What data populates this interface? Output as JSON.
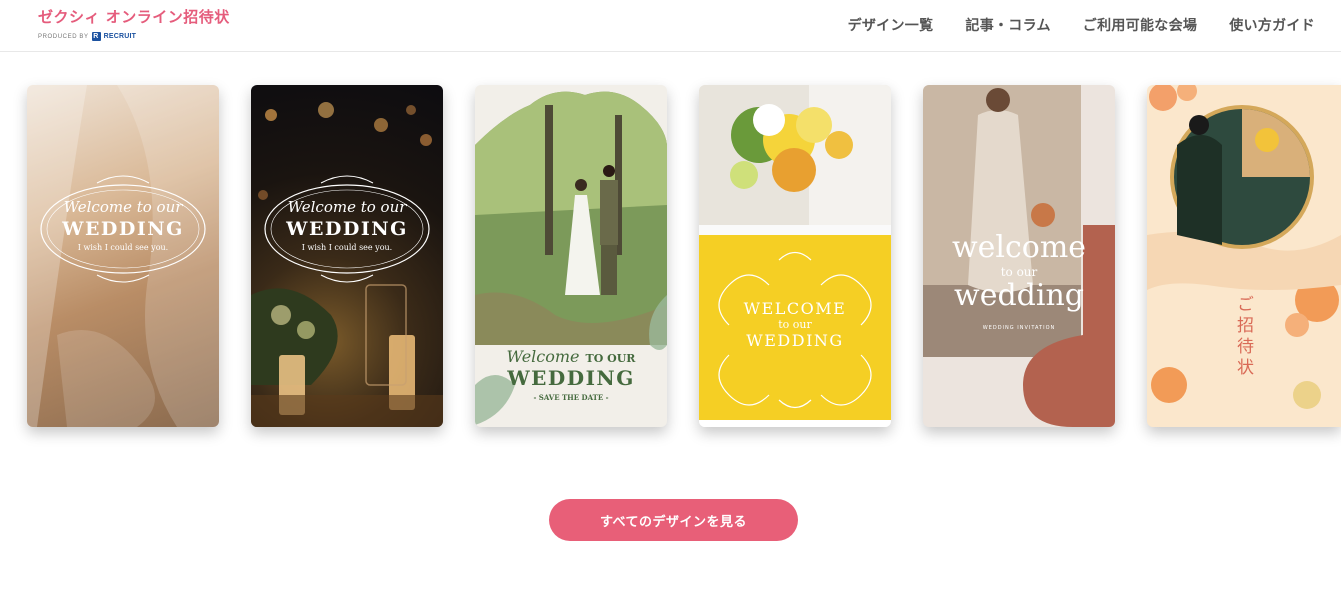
{
  "header": {
    "logo_main": "ゼクシィ オンライン招待状",
    "logo_produced_by": "PRODUCED BY",
    "logo_recruit": "RECRUIT"
  },
  "nav": {
    "items": [
      {
        "label": "デザイン一覧"
      },
      {
        "label": "記事・コラム"
      },
      {
        "label": "ご利用可能な会場"
      },
      {
        "label": "使い方ガイド"
      }
    ]
  },
  "cards": [
    {
      "script": "Welcome to our",
      "title": "WEDDING",
      "sub": "I wish I could see you."
    },
    {
      "script": "Welcome to our",
      "title": "WEDDING",
      "sub": "I wish I could see you."
    },
    {
      "script": "Welcome",
      "to_our": "TO OUR",
      "title": "WEDDING",
      "sub": "- SAVE THE DATE -"
    },
    {
      "line1": "WELCOME",
      "line2": "to our",
      "line3": "WEDDING"
    },
    {
      "line1": "welcome",
      "line2": "to our",
      "line3": "wedding",
      "sub": "WEDDING INVITATION"
    },
    {
      "vertical": "ご招待状"
    }
  ],
  "cta": {
    "label": "すべてのデザインを見る"
  },
  "colors": {
    "brand": "#e55c7c",
    "cta": "#e85f78",
    "recruit": "#1c52a0"
  }
}
